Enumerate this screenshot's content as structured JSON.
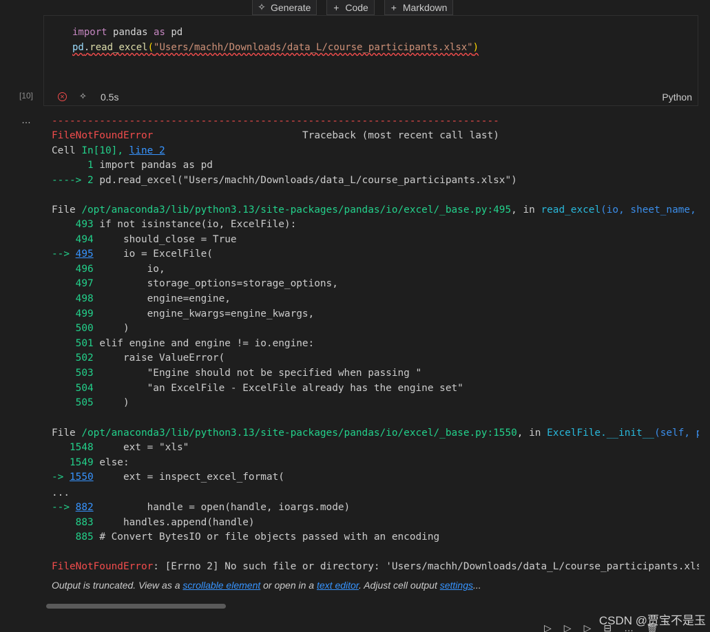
{
  "toolbar": {
    "generate_label": "Generate",
    "code_label": "Code",
    "markdown_label": "Markdown"
  },
  "cell": {
    "exec_count": "[10]",
    "duration": "0.5s",
    "language": "Python",
    "line1": {
      "kw": "import",
      "mod": "pandas",
      "as": "as",
      "alias": "pd"
    },
    "line2": {
      "obj": "pd",
      "dot": ".",
      "fn": "read_excel",
      "open": "(",
      "str": "\"Users/machh/Downloads/data_L/course_participants.xlsx\"",
      "close": ")"
    }
  },
  "output": {
    "dashes": "---------------------------------------------------------------------------",
    "error_name": "FileNotFoundError",
    "traceback_header": "Traceback (most recent call last)",
    "cell_prefix": "Cell ",
    "cell_in": "In[10]",
    "cell_comma": ", ",
    "cell_line_link": "line 2",
    "cell_lines": [
      {
        "arrow": "      ",
        "num": "1",
        "code": " import pandas as pd"
      },
      {
        "arrow": "----> ",
        "num": "2",
        "code": " pd.read_excel(\"Users/machh/Downloads/data_L/course_participants.xlsx\")"
      }
    ],
    "file1": {
      "prefix": "File ",
      "path": "/opt/anaconda3/lib/python3.13/site-packages/pandas/io/excel/_base.py:495",
      "in": ", in ",
      "func": "read_excel",
      "args": "(io, sheet_name, header, names, index_col, usecols, dtype)"
    },
    "file1_lines": [
      {
        "arrow": "    ",
        "num": "493",
        "code": " if not isinstance(io, ExcelFile):"
      },
      {
        "arrow": "    ",
        "num": "494",
        "code": "     should_close = True"
      },
      {
        "arrow": "--> ",
        "num": "495",
        "code": "     io = ExcelFile(",
        "link": true
      },
      {
        "arrow": "    ",
        "num": "496",
        "code": "         io,"
      },
      {
        "arrow": "    ",
        "num": "497",
        "code": "         storage_options=storage_options,"
      },
      {
        "arrow": "    ",
        "num": "498",
        "code": "         engine=engine,"
      },
      {
        "arrow": "    ",
        "num": "499",
        "code": "         engine_kwargs=engine_kwargs,"
      },
      {
        "arrow": "    ",
        "num": "500",
        "code": "     )"
      },
      {
        "arrow": "    ",
        "num": "501",
        "code": " elif engine and engine != io.engine:"
      },
      {
        "arrow": "    ",
        "num": "502",
        "code": "     raise ValueError("
      },
      {
        "arrow": "    ",
        "num": "503",
        "code": "         \"Engine should not be specified when passing \""
      },
      {
        "arrow": "    ",
        "num": "504",
        "code": "         \"an ExcelFile - ExcelFile already has the engine set\""
      },
      {
        "arrow": "    ",
        "num": "505",
        "code": "     )"
      }
    ],
    "file2": {
      "prefix": "File ",
      "path": "/opt/anaconda3/lib/python3.13/site-packages/pandas/io/excel/_base.py:1550",
      "in": ", in ",
      "func": "ExcelFile.__init__",
      "args": "(self, path_or_buffer, engine, storage_options)"
    },
    "file2_lines": [
      {
        "arrow": "   ",
        "num": "1548",
        "code": "     ext = \"xls\""
      },
      {
        "arrow": "   ",
        "num": "1549",
        "code": " else:"
      },
      {
        "arrow": "-> ",
        "num": "1550",
        "code": "     ext = inspect_excel_format(",
        "link": true
      }
    ],
    "ellipsis": "...",
    "file3_lines": [
      {
        "arrow": "--> ",
        "num": "882",
        "code": "         handle = open(handle, ioargs.mode)",
        "link": true
      },
      {
        "arrow": "    ",
        "num": "883",
        "code": "     handles.append(handle)"
      },
      {
        "arrow": "    ",
        "num": "885",
        "code": " # Convert BytesIO or file objects passed with an encoding"
      }
    ],
    "final_error_name": "FileNotFoundError",
    "final_error_msg": ": [Errno 2] No such file or directory: 'Users/machh/Downloads/data_L/course_participants.xlsx'"
  },
  "truncation": {
    "prefix": "Output is truncated. View as a ",
    "link1": "scrollable element",
    "mid1": " or open in a ",
    "link2": "text editor",
    "mid2": ". Adjust cell output ",
    "link3": "settings",
    "suffix": "..."
  },
  "watermark": "CSDN @贾宝不是玉"
}
